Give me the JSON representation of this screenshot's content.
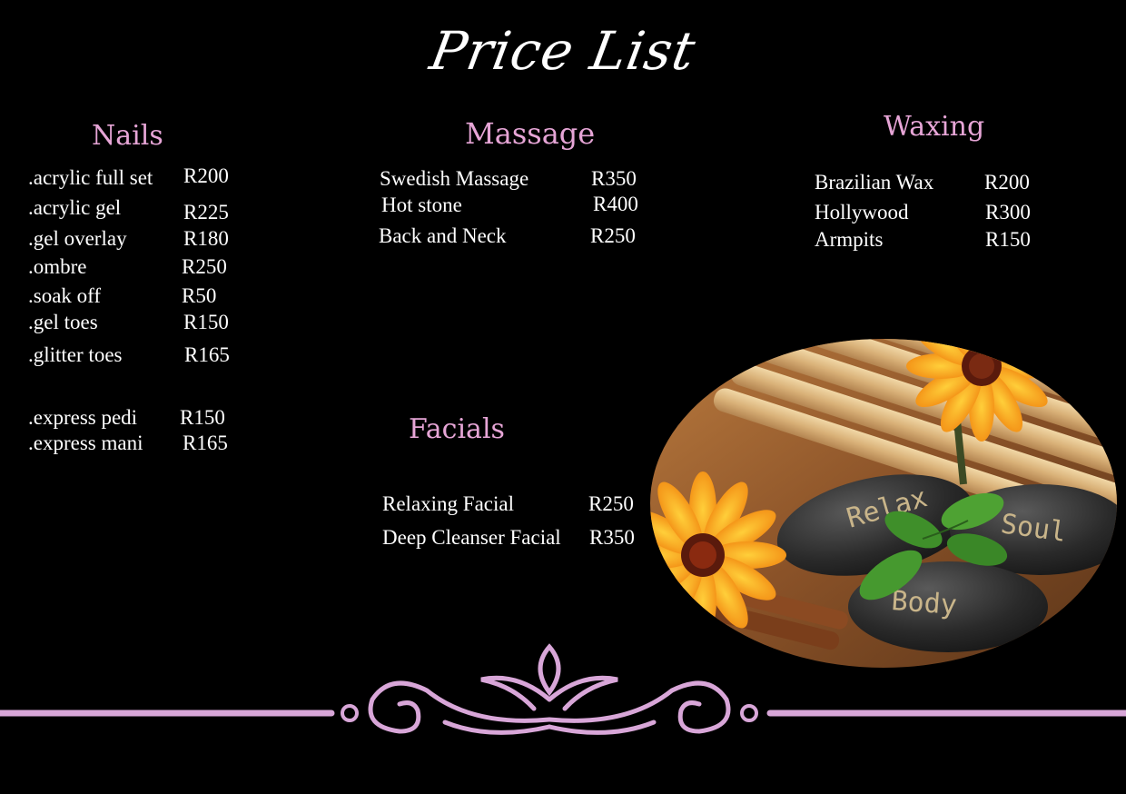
{
  "title": "Price List",
  "colors": {
    "background": "#000000",
    "heading": "#e6a5d6",
    "text": "#ffffff",
    "ornament": "#d8a6d8"
  },
  "nails": {
    "heading": "Nails",
    "items": [
      {
        "name": ".acrylic full set",
        "price": "R200"
      },
      {
        "name": ".acrylic gel",
        "price": "R225"
      },
      {
        "name": ".gel overlay",
        "price": "R180"
      },
      {
        "name": ".ombre",
        "price": "R250"
      },
      {
        "name": ".soak off",
        "price": "R50"
      },
      {
        "name": ".gel toes",
        "price": "R150"
      },
      {
        "name": ".glitter toes",
        "price": "R165"
      },
      {
        "name": ".express pedi",
        "price": "R150"
      },
      {
        "name": ".express mani",
        "price": "R165"
      }
    ]
  },
  "massage": {
    "heading": "Massage",
    "items": [
      {
        "name": "Swedish Massage",
        "price": "R350"
      },
      {
        "name": "Hot stone",
        "price": "R400"
      },
      {
        "name": "Back and Neck",
        "price": "R250"
      }
    ]
  },
  "waxing": {
    "heading": "Waxing",
    "items": [
      {
        "name": "Brazilian Wax",
        "price": "R200"
      },
      {
        "name": "Hollywood",
        "price": "R300"
      },
      {
        "name": "Armpits",
        "price": "R150"
      }
    ]
  },
  "facials": {
    "heading": "Facials",
    "items": [
      {
        "name": "Relaxing Facial",
        "price": "R250"
      },
      {
        "name": "Deep Cleanser Facial",
        "price": "R350"
      }
    ]
  },
  "photo": {
    "stones": [
      "Relax",
      "Soul",
      "Body"
    ]
  }
}
